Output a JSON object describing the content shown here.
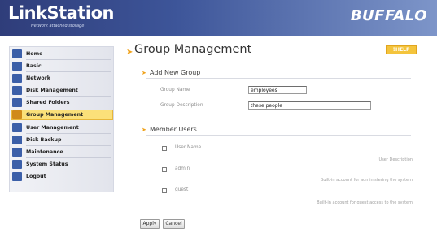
{
  "header": {
    "logo": "LinkStation",
    "tagline": "Network attached storage",
    "brand": "BUFFALO"
  },
  "sidebar": {
    "items": [
      {
        "label": "Home",
        "icon": "home-icon",
        "color": "#3b5fa8"
      },
      {
        "label": "Basic",
        "icon": "basic-settings-icon",
        "color": "#3b5fa8"
      },
      {
        "label": "Network",
        "icon": "network-icon",
        "color": "#3b5fa8"
      },
      {
        "label": "Disk Management",
        "icon": "disk-icon",
        "color": "#3b5fa8"
      },
      {
        "label": "Shared Folders",
        "icon": "folder-icon",
        "color": "#3b5fa8"
      },
      {
        "label": "Group Management",
        "icon": "group-icon",
        "color": "#d08a1a",
        "active": true
      },
      {
        "label": "User Management",
        "icon": "user-icon",
        "color": "#3b5fa8"
      },
      {
        "label": "Disk Backup",
        "icon": "backup-icon",
        "color": "#3b5fa8"
      },
      {
        "label": "Maintenance",
        "icon": "maintenance-icon",
        "color": "#3b5fa8"
      },
      {
        "label": "System Status",
        "icon": "status-icon",
        "color": "#3b5fa8"
      },
      {
        "label": "Logout",
        "icon": "logout-icon",
        "color": "#3b5fa8"
      }
    ]
  },
  "main": {
    "title": "Group Management",
    "help": "?HELP",
    "add_group": {
      "title": "Add New Group",
      "name_label": "Group Name",
      "name_value": "employees",
      "desc_label": "Group Description",
      "desc_value": "these people"
    },
    "members": {
      "title": "Member Users",
      "col_user": "User Name",
      "col_desc": "User Description",
      "users": [
        {
          "name": "admin",
          "description": "Built-in account for administering the system"
        },
        {
          "name": "guest",
          "description": "Built-in account for guest access to the system"
        }
      ]
    },
    "apply_label": "Apply",
    "cancel_label": "Cancel"
  },
  "colors": {
    "accent": "#f0a21a",
    "header": "#3d5599",
    "active_nav": "#fbe079"
  }
}
